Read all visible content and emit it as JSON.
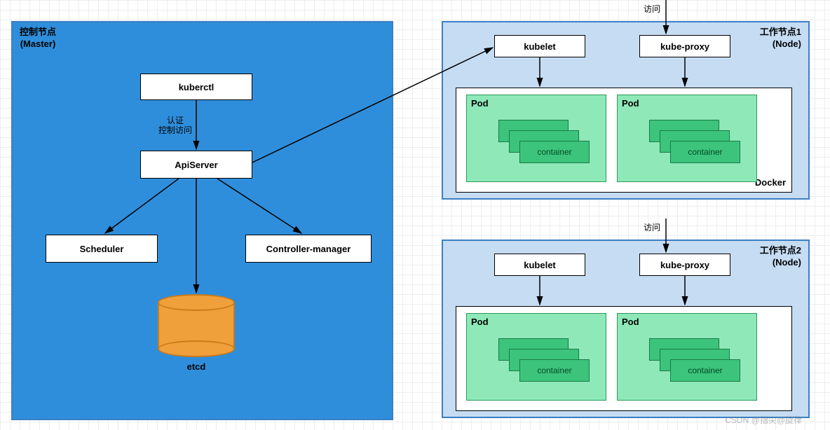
{
  "master": {
    "title": "控制节点\n(Master)",
    "kuberctl": "kuberctl",
    "apiserver": "ApiServer",
    "scheduler": "Scheduler",
    "controller_manager": "Controller-manager",
    "etcd": "etcd",
    "auth_label": "认证\n控制访问"
  },
  "node1": {
    "title": "工作节点1\n(Node)",
    "access": "访问",
    "kubelet": "kubelet",
    "kubeproxy": "kube-proxy",
    "docker": "Docker",
    "pod": "Pod",
    "container": "container"
  },
  "node2": {
    "title": "工作节点2\n(Node)",
    "access": "访问",
    "kubelet": "kubelet",
    "kubeproxy": "kube-proxy",
    "pod": "Pod",
    "container": "container"
  },
  "watermark": "CSDN @指尖@旋律",
  "colors": {
    "master_bg": "#2f8edb",
    "node_bg": "#c5dcf3",
    "pod_bg": "#8ee8b8",
    "container_bg": "#3cc47c",
    "etcd_bg": "#f0a03a"
  }
}
